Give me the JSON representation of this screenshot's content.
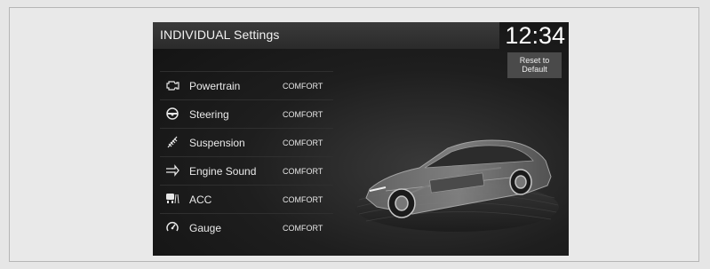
{
  "header": {
    "title": "INDIVIDUAL Settings",
    "clock": "12:34"
  },
  "reset_button": {
    "line1": "Reset to",
    "line2": "Default"
  },
  "menu": {
    "items": [
      {
        "label": "Powertrain",
        "value": "COMFORT",
        "icon": "engine-icon"
      },
      {
        "label": "Steering",
        "value": "COMFORT",
        "icon": "steering-wheel-icon"
      },
      {
        "label": "Suspension",
        "value": "COMFORT",
        "icon": "suspension-icon"
      },
      {
        "label": "Engine Sound",
        "value": "COMFORT",
        "icon": "engine-sound-icon"
      },
      {
        "label": "ACC",
        "value": "COMFORT",
        "icon": "acc-icon"
      },
      {
        "label": "Gauge",
        "value": "COMFORT",
        "icon": "gauge-icon"
      }
    ]
  }
}
